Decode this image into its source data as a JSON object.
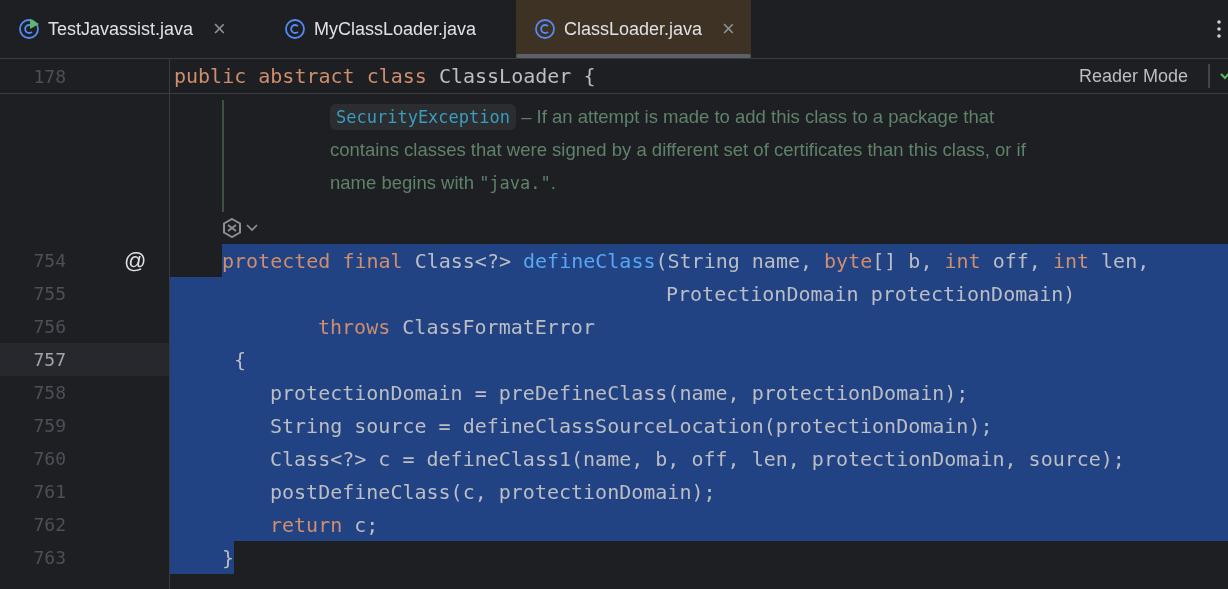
{
  "tabs": [
    {
      "label": "TestJavassist.java",
      "selected": false,
      "kind": "runnable",
      "closable": true
    },
    {
      "label": "MyClassLoader.java",
      "selected": false,
      "kind": "class",
      "closable": false
    },
    {
      "label": "ClassLoader.java",
      "selected": true,
      "kind": "class",
      "closable": true
    }
  ],
  "close_glyph": "×",
  "sticky_line": {
    "number": "178",
    "tokens": [
      {
        "t": "public abstract class ",
        "kind": "keyword"
      },
      {
        "t": "ClassLoader {",
        "kind": "plain"
      }
    ]
  },
  "reader_mode": "Reader Mode",
  "doc_lines": [
    [
      {
        "t": "SecurityException",
        "kind": "tag"
      },
      {
        "t": " – If an attempt is made to add this class to a package that",
        "kind": "text"
      }
    ],
    [
      {
        "t": "contains classes that were signed by a different set of certificates than this class, or if",
        "kind": "text"
      }
    ],
    [
      {
        "t": "name begins with ",
        "kind": "text"
      },
      {
        "t": "\"java.\"",
        "kind": "mono"
      },
      {
        "t": ".",
        "kind": "text"
      }
    ]
  ],
  "code_lines": [
    {
      "number": "754",
      "current": false,
      "selected": true,
      "kind": "signature",
      "annotation": "@",
      "tokens": [
        {
          "t": "protected final ",
          "kind": "keyword"
        },
        {
          "t": "Class<?> ",
          "kind": "plain"
        },
        {
          "t": "defineClass",
          "kind": "function"
        },
        {
          "t": "(String name, ",
          "kind": "plain"
        },
        {
          "t": "byte",
          "kind": "keyword"
        },
        {
          "t": "[] b, ",
          "kind": "plain"
        },
        {
          "t": "int ",
          "kind": "keyword"
        },
        {
          "t": "off, ",
          "kind": "plain"
        },
        {
          "t": "int ",
          "kind": "keyword"
        },
        {
          "t": "len,",
          "kind": "plain"
        }
      ]
    },
    {
      "number": "755",
      "current": false,
      "selected": true,
      "kind": "continuation",
      "tokens": [
        {
          "t": "ProtectionDomain protectionDomain)",
          "kind": "plain"
        }
      ]
    },
    {
      "number": "756",
      "current": false,
      "selected": true,
      "kind": "throws",
      "tokens": [
        {
          "t": "throws ",
          "kind": "keyword"
        },
        {
          "t": "ClassFormatError",
          "kind": "plain"
        }
      ]
    },
    {
      "number": "757",
      "current": true,
      "selected": true,
      "kind": "open",
      "tokens": [
        {
          "t": "{",
          "kind": "plain"
        }
      ]
    },
    {
      "number": "758",
      "current": false,
      "selected": true,
      "kind": "body",
      "tokens": [
        {
          "t": "protectionDomain = preDefineClass(name, protectionDomain);",
          "kind": "plain"
        }
      ]
    },
    {
      "number": "759",
      "current": false,
      "selected": true,
      "kind": "body",
      "tokens": [
        {
          "t": "String source = defineClassSourceLocation(protectionDomain);",
          "kind": "plain"
        }
      ]
    },
    {
      "number": "760",
      "current": false,
      "selected": true,
      "kind": "body",
      "tokens": [
        {
          "t": "Class<?> c = defineClass1(name, b, off, len, protectionDomain, source);",
          "kind": "plain"
        }
      ]
    },
    {
      "number": "761",
      "current": false,
      "selected": true,
      "kind": "body",
      "tokens": [
        {
          "t": "postDefineClass(c, protectionDomain);",
          "kind": "plain"
        }
      ]
    },
    {
      "number": "762",
      "current": false,
      "selected": true,
      "kind": "body",
      "tokens": [
        {
          "t": "return ",
          "kind": "keyword"
        },
        {
          "t": "c;",
          "kind": "plain"
        }
      ]
    },
    {
      "number": "763",
      "current": false,
      "selected": true,
      "kind": "close",
      "tokens": [
        {
          "t": "}",
          "kind": "plain"
        }
      ]
    }
  ]
}
